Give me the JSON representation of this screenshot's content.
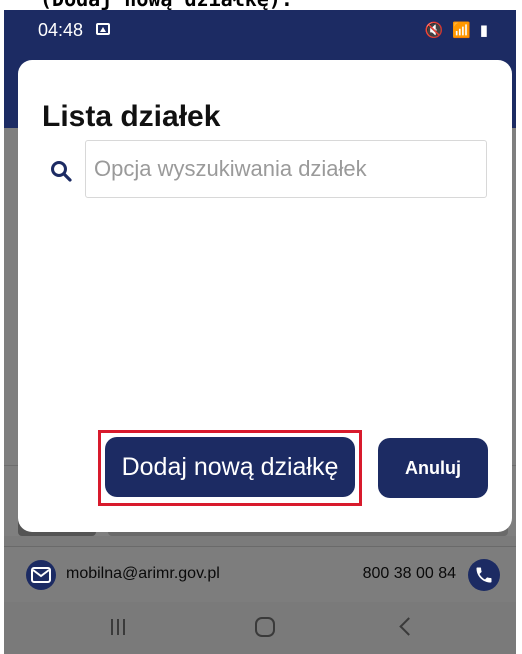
{
  "caption": {
    "text": "(Dodaj nową działkę)."
  },
  "status_bar": {
    "time": "04:48",
    "icons_text": "🔇 📶 ▮"
  },
  "dialog": {
    "title": "Lista działek",
    "search": {
      "placeholder": "Opcja wyszukiwania działek",
      "value": ""
    },
    "add_button_label": "Dodaj nową działkę",
    "cancel_button_label": "Anuluj",
    "highlight_color": "#d81a2c"
  },
  "footer": {
    "email": "mobilna@arimr.gov.pl",
    "phone": "800 38 00 84",
    "email_icon": "envelope-icon",
    "phone_icon": "phone-icon"
  },
  "nav": {
    "recent_icon": "recent-apps-icon",
    "home_icon": "home-icon",
    "back_icon": "back-icon"
  },
  "colors": {
    "primary": "#1c2b63",
    "scrim": "#7f7f7f"
  }
}
